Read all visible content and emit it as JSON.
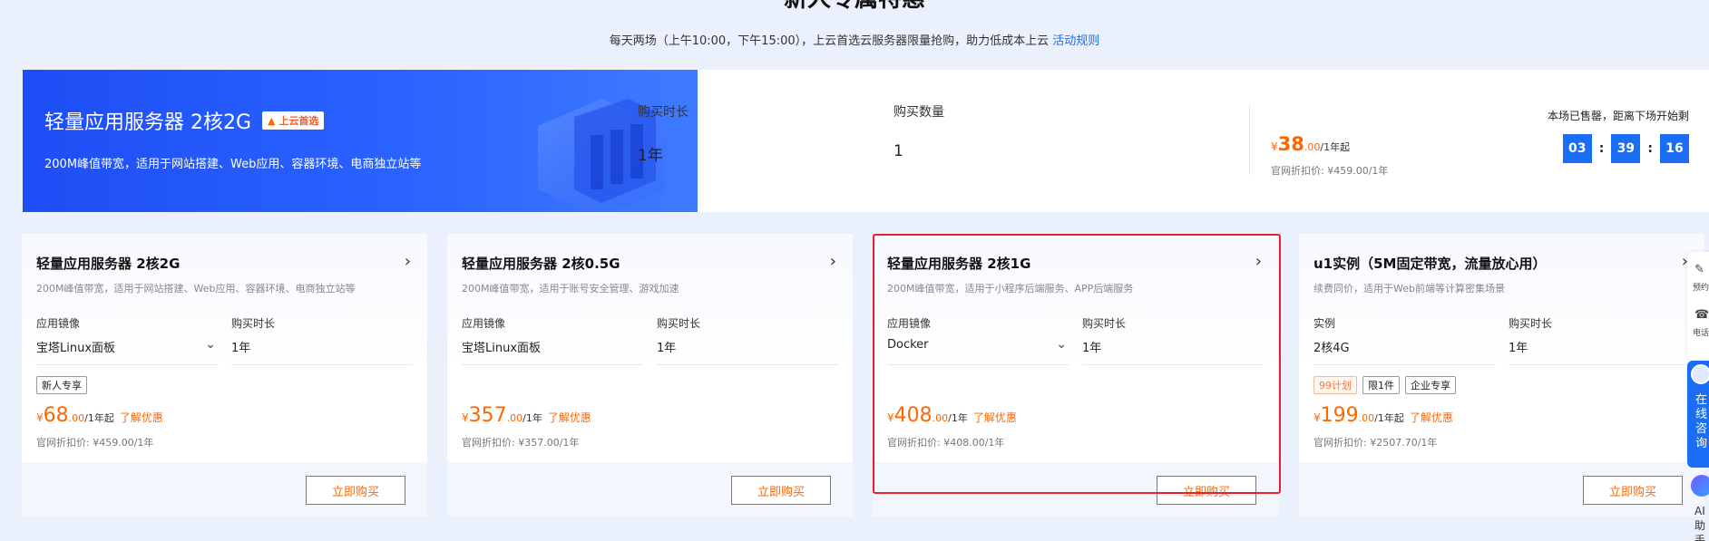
{
  "page": {
    "heading": "新人专属特惠",
    "subtitle": "每天两场（上午10:00，下午15:00），上云首选云服务器限量抢购，助力低成本上云",
    "rules_link": "活动规则"
  },
  "banner": {
    "title": "轻量应用服务器 2核2G",
    "badge": "上云首选",
    "desc": "200M峰值带宽，适用于网站搭建、Web应用、容器环境、电商独立站等",
    "duration_label": "购买时长",
    "duration_value": "1年",
    "qty_label": "购买数量",
    "qty_value": "1",
    "price_currency": "¥",
    "price_amount": "38",
    "price_decimal": ".00",
    "price_unit": "/1年",
    "price_suffix": "起",
    "orig_price": "官网折扣价: ¥459.00/1年",
    "countdown_label": "本场已售罄，距离下场开始剩",
    "countdown": {
      "h": "03",
      "m": "39",
      "s": "16",
      "sep": ":"
    }
  },
  "cards": [
    {
      "title": "轻量应用服务器 2核2G",
      "desc": "200M峰值带宽，适用于网站搭建、Web应用、容器环境、电商独立站等",
      "field1_label": "应用镜像",
      "field1_value": "宝塔Linux面板",
      "field2_label": "购买时长",
      "field2_value": "1年",
      "tags": [
        "新人专享"
      ],
      "currency": "¥",
      "amount": "68",
      "decimal": ".00",
      "unit": "/1年",
      "suffix": "起",
      "learn": "了解优惠",
      "orig": "官网折扣价: ¥459.00/1年",
      "buy": "立即购买"
    },
    {
      "title": "轻量应用服务器 2核0.5G",
      "desc": "200M峰值带宽，适用于账号安全管理、游戏加速",
      "field1_label": "应用镜像",
      "field1_value": "宝塔Linux面板",
      "field2_label": "购买时长",
      "field2_value": "1年",
      "tags": [],
      "currency": "¥",
      "amount": "357",
      "decimal": ".00",
      "unit": "/1年",
      "suffix": "",
      "learn": "了解优惠",
      "orig": "官网折扣价: ¥357.00/1年",
      "buy": "立即购买"
    },
    {
      "title": "轻量应用服务器 2核1G",
      "desc": "200M峰值带宽，适用于小程序后端服务、APP后端服务",
      "field1_label": "应用镜像",
      "field1_value": "Docker",
      "field2_label": "购买时长",
      "field2_value": "1年",
      "tags": [],
      "currency": "¥",
      "amount": "408",
      "decimal": ".00",
      "unit": "/1年",
      "suffix": "",
      "learn": "了解优惠",
      "orig": "官网折扣价: ¥408.00/1年",
      "buy": "立即购买"
    },
    {
      "title": "u1实例（5M固定带宽，流量放心用）",
      "desc": "续费同价，适用于Web前端等计算密集场景",
      "field1_label": "实例",
      "field1_value": "2核4G",
      "field2_label": "购买时长",
      "field2_value": "1年",
      "tags": [
        "99计划",
        "限1件",
        "企业专享"
      ],
      "currency": "¥",
      "amount": "199",
      "decimal": ".00",
      "unit": "/1年",
      "suffix": "起",
      "learn": "了解优惠",
      "orig": "官网折扣价: ¥2507.70/1年",
      "buy": "立即购买"
    }
  ],
  "sidebar": {
    "item1": "预约",
    "item2": "电话",
    "chat": "在线咨询",
    "ai": "AI助手"
  }
}
